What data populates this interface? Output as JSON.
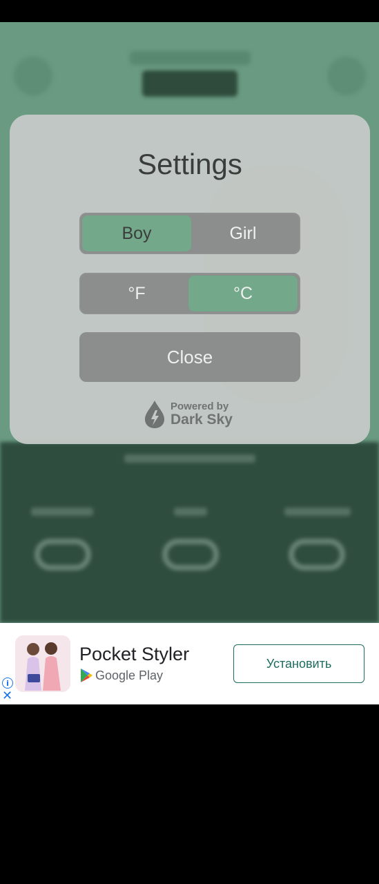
{
  "settings": {
    "title": "Settings",
    "gender": {
      "options": [
        "Boy",
        "Girl"
      ],
      "selected": "Boy"
    },
    "units": {
      "options": [
        "°F",
        "°C"
      ],
      "selected": "°C"
    },
    "close_label": "Close",
    "powered_by": {
      "line1": "Powered by",
      "line2": "Dark Sky"
    }
  },
  "ad": {
    "app_name": "Pocket Styler",
    "store": "Google Play",
    "install_label": "Установить",
    "info_icon": "info-icon",
    "close_icon": "close-icon"
  },
  "colors": {
    "accent_green": "#74a88b",
    "app_background": "#6a9a82",
    "install_text": "#1e6b5f"
  }
}
